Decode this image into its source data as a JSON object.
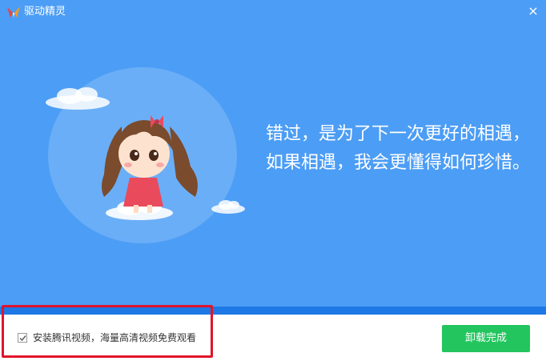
{
  "window": {
    "title": "驱动精灵",
    "close_glyph": "×"
  },
  "banner": {
    "slogan_line1": "错过，是为了下一次更好的相遇，",
    "slogan_line2": "如果相遇，我会更懂得如何珍惜。"
  },
  "footer": {
    "checkbox_checked": true,
    "checkbox_label": "安装腾讯视频，海量高清视频免费观看",
    "finish_button_label": "卸载完成"
  },
  "colors": {
    "banner_bg": "#4c9df5",
    "progress_strip": "#1e78e6",
    "finish_button": "#23c55e",
    "annotation_border": "#e0142b"
  },
  "icons": {
    "app_logo": "butterfly-logo-icon",
    "close": "close-icon",
    "check": "checkmark-icon"
  }
}
